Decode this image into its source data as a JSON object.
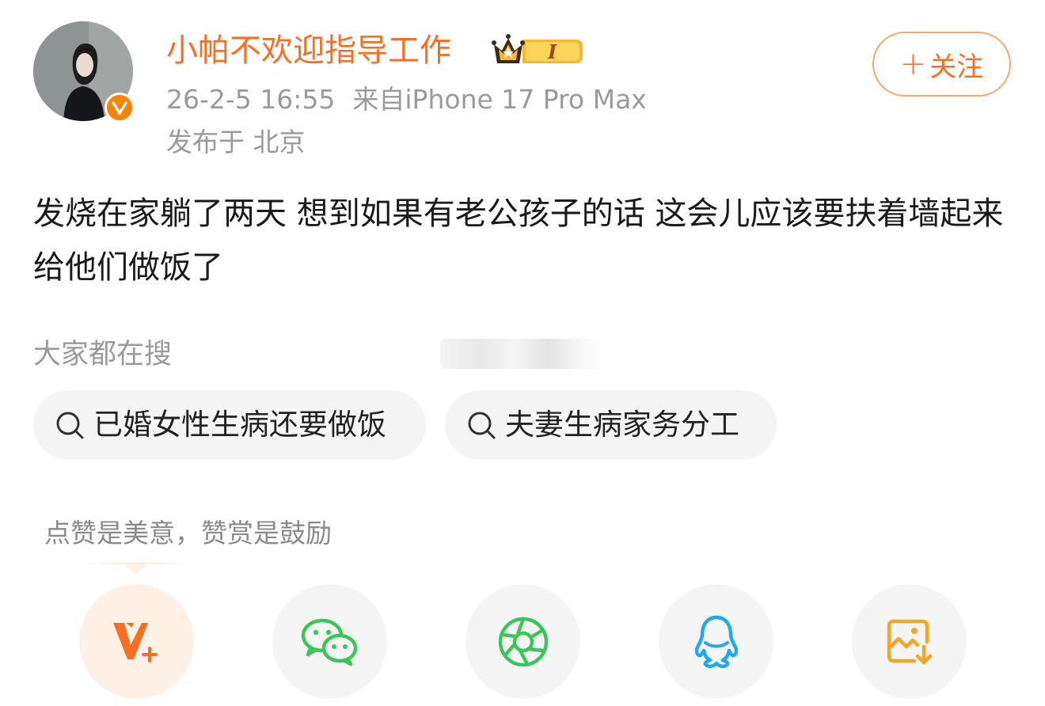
{
  "post": {
    "author": {
      "name": "小帕不欢迎指导工作",
      "vip_level": "I",
      "verified": true
    },
    "time": "26-2-5 16:55",
    "source": "来自iPhone 17 Pro Max",
    "location": "发布于 北京",
    "follow_button": "关注",
    "content": "发烧在家躺了两天 想到如果有老公孩子的话 这会儿应该要扶着墙起来给他们做饭了"
  },
  "trending": {
    "title": "大家都在搜",
    "chips": [
      {
        "label": "已婚女性生病还要做饭",
        "icon": "search-icon"
      },
      {
        "label": "夫妻生病家务分工",
        "icon": "search-icon"
      }
    ]
  },
  "reward_tip": "点赞是美意，赞赏是鼓励",
  "share": {
    "items": [
      {
        "name": "reward",
        "icon": "v-plus-icon",
        "color": "#f86f24"
      },
      {
        "name": "wechat",
        "icon": "wechat-icon",
        "color": "#3cc55a"
      },
      {
        "name": "moments",
        "icon": "moments-icon",
        "color": "#3cc55a"
      },
      {
        "name": "qq",
        "icon": "qq-icon",
        "color": "#21a8f0"
      },
      {
        "name": "save-image",
        "icon": "save-image-icon",
        "color": "#f5a623"
      }
    ]
  },
  "colors": {
    "accent": "#f86f24",
    "meta": "#9a9a9a",
    "chip_bg": "#f5f5f5"
  }
}
